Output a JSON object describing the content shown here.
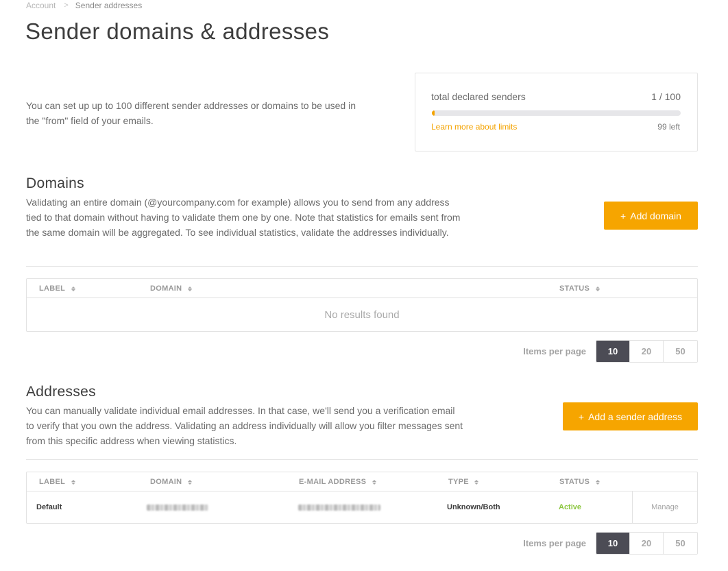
{
  "breadcrumb": {
    "parent": "Account",
    "separator": ">",
    "current": "Sender addresses"
  },
  "page_title": "Sender domains & addresses",
  "intro": "You can set up up to 100 different sender addresses or domains to be used in the \"from\" field of your emails.",
  "quota": {
    "label": "total declared senders",
    "count": "1 / 100",
    "used": 1,
    "total": 100,
    "link": "Learn more about limits",
    "remaining": "99 left"
  },
  "domains": {
    "title": "Domains",
    "description": "Validating an entire domain (@yourcompany.com for example) allows you to send from any address tied to that domain without having to validate them one by one. Note that statistics for emails sent from the same domain will be aggregated. To see individual statistics, validate the addresses individually.",
    "add_button": "Add domain",
    "columns": [
      "LABEL",
      "DOMAIN",
      "STATUS"
    ],
    "empty_text": "No results found",
    "pager": {
      "label": "Items per page",
      "options": [
        "10",
        "20",
        "50"
      ],
      "selected": "10"
    }
  },
  "addresses": {
    "title": "Addresses",
    "description": "You can manually validate individual email addresses. In that case, we'll send you a verification email to verify that you own the address. Validating an address individually will allow you filter messages sent from this specific address when viewing statistics.",
    "add_button": "Add a sender address",
    "columns": [
      "LABEL",
      "DOMAIN",
      "E-MAIL ADDRESS",
      "TYPE",
      "STATUS"
    ],
    "rows": [
      {
        "label": "Default",
        "type": "Unknown/Both",
        "status": "Active",
        "action": "Manage"
      }
    ],
    "pager": {
      "label": "Items per page",
      "options": [
        "10",
        "20",
        "50"
      ],
      "selected": "10"
    }
  },
  "colors": {
    "accent": "#f6a500",
    "active_status": "#8cc63f",
    "pager_active": "#4c4c55"
  },
  "icons": {
    "plus": "plus-icon",
    "sort": "sort-icon",
    "breadcrumb_sep": "chevron-right-icon"
  }
}
